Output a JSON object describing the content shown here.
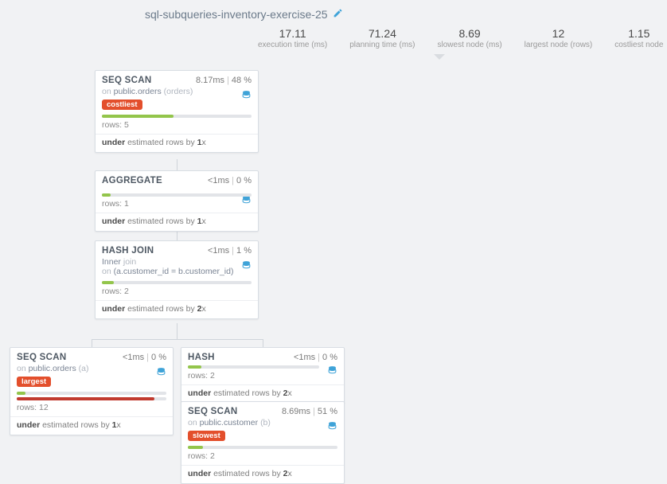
{
  "header": {
    "title": "sql-subqueries-inventory-exercise-25"
  },
  "stats": {
    "exec_time": {
      "value": "17.11",
      "label": "execution time (ms)"
    },
    "plan_time": {
      "value": "71.24",
      "label": "planning time (ms)"
    },
    "slowest": {
      "value": "8.69",
      "label": "slowest node (ms)"
    },
    "largest": {
      "value": "12",
      "label": "largest node (rows)"
    },
    "costliest": {
      "value": "1.15",
      "label": "costliest node"
    }
  },
  "nodes": {
    "n1": {
      "type": "SEQ SCAN",
      "time": "8.17ms",
      "pct": "48 %",
      "sub_prefix": "on ",
      "sub_main": "public.orders ",
      "sub_alias": "(orders)",
      "tag": "costliest",
      "barA_width": "48%",
      "rows": "rows: 5",
      "est_prefix": "under ",
      "est_mid": "estimated rows by ",
      "est_factor": "1",
      "est_suffix": "x"
    },
    "n2": {
      "type": "AGGREGATE",
      "time": "<1ms",
      "pct": "0 %",
      "barA_width": "6%",
      "rows": "rows: 1",
      "est_prefix": "under ",
      "est_mid": "estimated rows by ",
      "est_factor": "1",
      "est_suffix": "x"
    },
    "n3": {
      "type": "HASH JOIN",
      "time": "<1ms",
      "pct": "1 %",
      "line1_a": "Inner ",
      "line1_b": "join",
      "line2_a": "on ",
      "line2_b": "(a.customer_id = b.customer_id)",
      "barA_width": "8%",
      "rows": "rows: 2",
      "est_prefix": "under ",
      "est_mid": "estimated rows by ",
      "est_factor": "2",
      "est_suffix": "x"
    },
    "n4": {
      "type": "SEQ SCAN",
      "time": "<1ms",
      "pct": "0 %",
      "sub_prefix": "on ",
      "sub_main": "public.orders ",
      "sub_alias": "(a)",
      "tag": "largest",
      "barA_width": "6%",
      "barB_width": "92%",
      "rows": "rows: 12",
      "est_prefix": "under ",
      "est_mid": "estimated rows by ",
      "est_factor": "1",
      "est_suffix": "x"
    },
    "n5": {
      "type": "HASH",
      "time": "<1ms",
      "pct": "0 %",
      "barA_width": "10%",
      "rows": "rows: 2",
      "est_prefix": "under ",
      "est_mid": "estimated rows by ",
      "est_factor": "2",
      "est_suffix": "x"
    },
    "n6": {
      "type": "SEQ SCAN",
      "time": "8.69ms",
      "pct": "51 %",
      "sub_prefix": "on ",
      "sub_main": "public.customer ",
      "sub_alias": "(b)",
      "tag": "slowest",
      "barA_width": "10%",
      "rows": "rows: 2",
      "est_prefix": "under ",
      "est_mid": "estimated rows by ",
      "est_factor": "2",
      "est_suffix": "x"
    }
  }
}
